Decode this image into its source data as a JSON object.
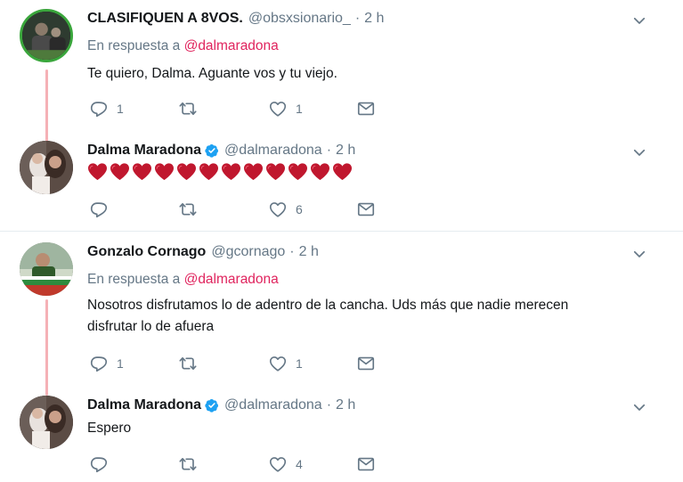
{
  "tweets": [
    {
      "name": "CLASIFIQUEN A 8VOS.",
      "handle": "@obsxsionario_",
      "time": "2 h",
      "reply_prefix": "En respuesta a",
      "reply_mention": "@dalmaradona",
      "text": "Te quiero, Dalma. Aguante vos y tu viejo.",
      "reply_count": "1",
      "retweet_count": "",
      "like_count": "1",
      "avatar": "profile-photo-icon"
    },
    {
      "name": "Dalma Maradona",
      "handle": "@dalmaradona",
      "time": "2 h",
      "verified": true,
      "hearts": 12,
      "heart_color": "#c0172e",
      "reply_count": "",
      "retweet_count": "",
      "like_count": "6",
      "avatar": "profile-photo-icon"
    },
    {
      "name": "Gonzalo Cornago",
      "handle": "@gcornago",
      "time": "2 h",
      "reply_prefix": "En respuesta a",
      "reply_mention": "@dalmaradona",
      "text_line1": "Nosotros disfrutamos lo de adentro de la cancha. Uds más que nadie merecen",
      "text_line2": "disfrutar lo de afuera",
      "reply_count": "1",
      "retweet_count": "",
      "like_count": "1",
      "avatar": "profile-photo-icon"
    },
    {
      "name": "Dalma Maradona",
      "handle": "@dalmaradona",
      "time": "2 h",
      "verified": true,
      "text": "Espero",
      "reply_count": "",
      "retweet_count": "",
      "like_count": "4",
      "avatar": "profile-photo-icon"
    }
  ],
  "dot": "·",
  "colors": {
    "mention": "#e0245e",
    "thread_line": "#f5b1b6",
    "verified": "#1da1f2",
    "muted": "#657786"
  }
}
